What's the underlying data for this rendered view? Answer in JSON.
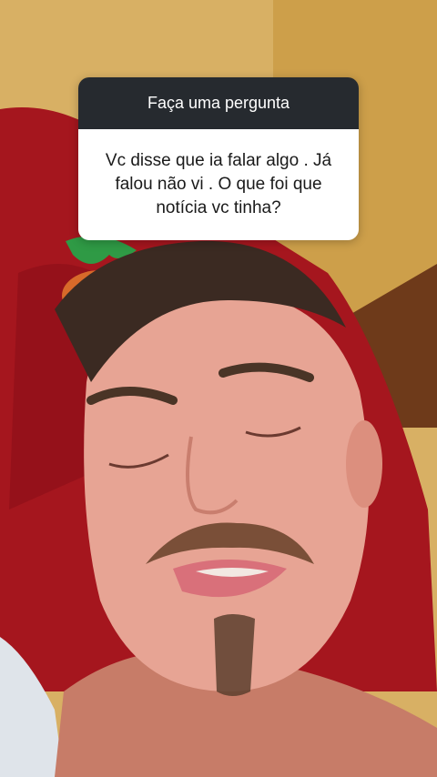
{
  "question_sticker": {
    "title": "Faça uma pergunta",
    "question": "Vc disse que ia falar algo . Já falou não vi . O que foi que notícia vc tinha?"
  },
  "colors": {
    "header_bg": "#262a2f",
    "body_bg": "#ffffff",
    "wall": "#d9b56a",
    "pillow": "#a5161e",
    "skin": "#e7a494"
  }
}
